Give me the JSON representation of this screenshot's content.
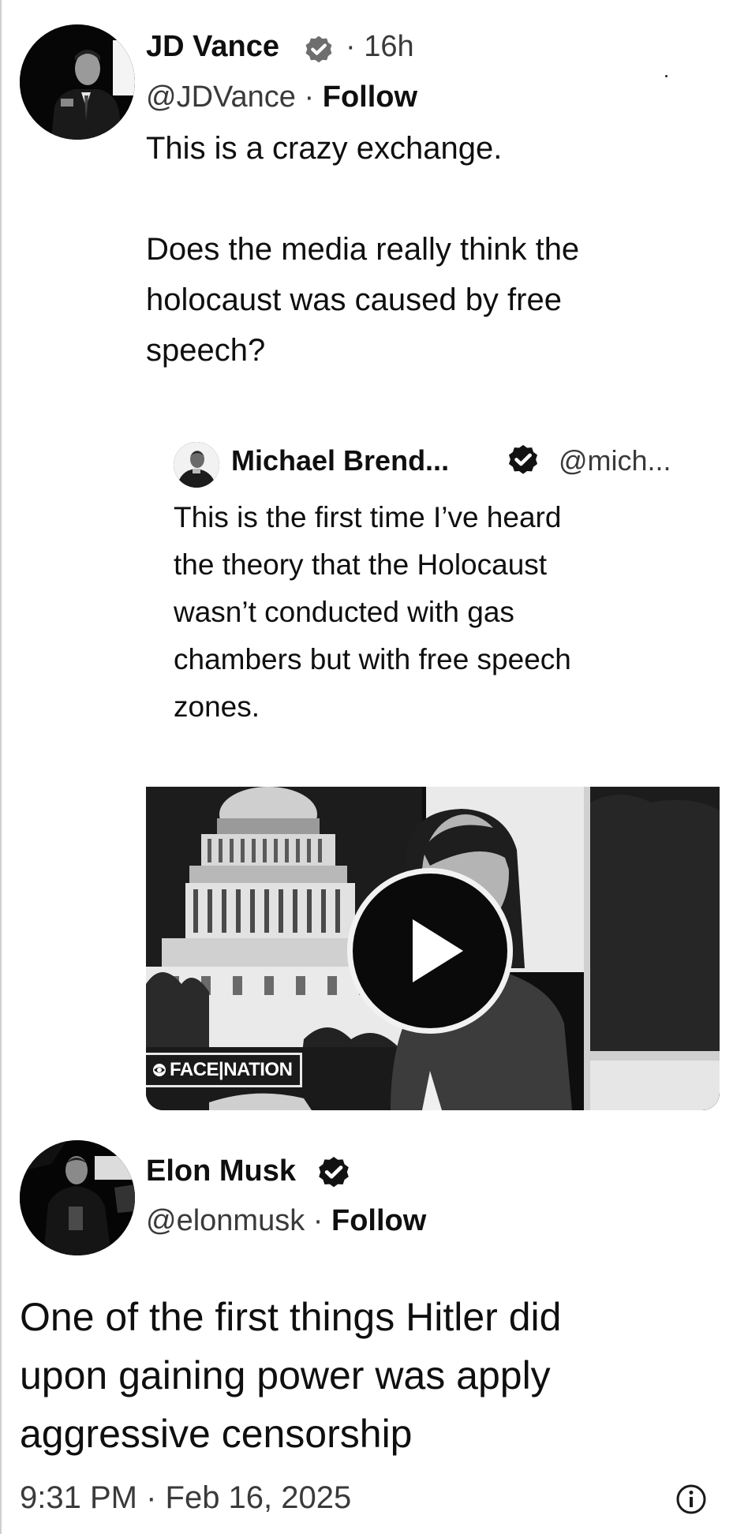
{
  "main_tweet": {
    "author_name": "JD Vance",
    "verified_icon": "gray-verified-badge-icon",
    "time_ago": "16h",
    "handle": "@JDVance",
    "follow_label": "Follow",
    "separator": "·",
    "text": "This is a crazy exchange.\n\nDoes the media really think the\nholocaust was caused by free\nspeech?"
  },
  "quoted_tweet": {
    "author_name": "Michael Brend...",
    "verified_icon": "verified-badge-icon",
    "handle": "@mich...",
    "text": "This is the first time I’ve heard\nthe theory that the Holocaust\nwasn’t conducted with gas\nchambers but with free speech\nzones.",
    "video": {
      "watermark": "FACE|NATION",
      "play_icon": "play-icon"
    }
  },
  "reply_tweet": {
    "author_name": "Elon Musk",
    "verified_icon": "verified-badge-icon",
    "handle": "@elonmusk",
    "follow_label": "Follow",
    "separator": "·",
    "text": "One of the first things Hitler did\nupon gaining power was apply\naggressive censorship",
    "timestamp": "9:31 PM · Feb 16, 2025",
    "info_icon": "info-icon"
  }
}
